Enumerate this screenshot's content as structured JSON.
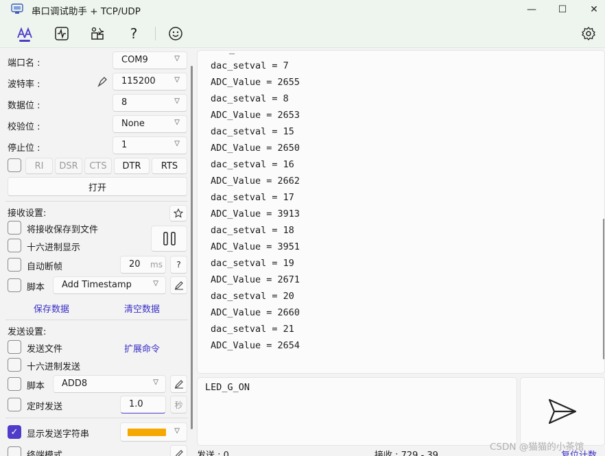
{
  "window": {
    "title": "串口调试助手 + TCP/UDP",
    "minimize": "—",
    "maximize": "☐",
    "close": "✕"
  },
  "toolbar": {
    "icons": [
      "text-mode-icon",
      "waveform-icon",
      "plugin-icon",
      "help-icon",
      "emoji-icon",
      "settings-icon"
    ],
    "help_label": "?",
    "accent": "#4f3cc9"
  },
  "port": {
    "port_label": "端口名 :",
    "port_value": "COM9",
    "baud_label": "波特率 :",
    "baud_value": "115200",
    "databits_label": "数据位 :",
    "databits_value": "8",
    "parity_label": "校验位 :",
    "parity_value": "None",
    "stopbits_label": "停止位 :",
    "stopbits_value": "1",
    "signals": [
      "RI",
      "DSR",
      "CTS",
      "DTR",
      "RTS"
    ],
    "open_label": "打开"
  },
  "receive": {
    "heading": "接收设置:",
    "save_to_file": "将接收保存到文件",
    "hex_display": "十六进制显示",
    "auto_frame": "自动断帧",
    "auto_frame_value": "20",
    "auto_frame_unit": "ms",
    "help": "?",
    "script_label": "脚本",
    "script_value": "Add Timestamp",
    "save_data": "保存数据",
    "clear_data": "清空数据"
  },
  "send": {
    "heading": "发送设置:",
    "send_file": "发送文件",
    "ext_cmd": "扩展命令",
    "hex_send": "十六进制发送",
    "script_label": "脚本",
    "script_value": "ADD8",
    "timed_send": "定时发送",
    "timed_value": "1.0",
    "timed_unit": "秒",
    "show_send_string": "显示发送字符串",
    "show_send_color": "#f5a800",
    "terminal_mode": "终端模式",
    "input_text": "LED_G_ON"
  },
  "receive_log": {
    "top_fragment": "_",
    "lines": [
      "dac_setval = 7",
      "ADC_Value = 2655",
      "dac_setval = 8",
      "ADC_Value = 2653",
      "dac_setval = 15",
      "ADC_Value = 2650",
      "dac_setval = 16",
      "ADC_Value = 2662",
      "dac_setval = 17",
      "ADC_Value = 3913",
      "dac_setval = 18",
      "ADC_Value = 3951",
      "dac_setval = 19",
      "ADC_Value = 2671",
      "dac_setval = 20",
      "ADC_Value = 2660",
      "dac_setval = 21",
      "ADC_Value = 2654"
    ]
  },
  "status": {
    "sent": "发送 : 0",
    "received": "接收 : 729 - 39",
    "reset": "复位计数"
  },
  "watermark": "CSDN @猫猫的小茶馆"
}
